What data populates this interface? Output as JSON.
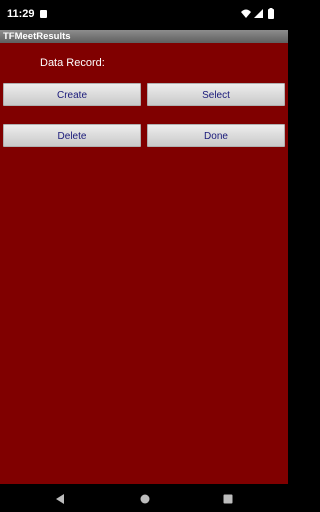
{
  "status_bar": {
    "time": "11:29",
    "icons": [
      "sim-icon",
      "wifi-icon",
      "signal-icon",
      "battery-icon"
    ]
  },
  "app": {
    "title": "TFMeetResults"
  },
  "main": {
    "data_record_label": "Data Record:",
    "buttons": {
      "create": "Create",
      "select": "Select",
      "delete": "Delete",
      "done": "Done"
    }
  },
  "nav_bar": {
    "icons": [
      "back-icon",
      "home-icon",
      "recents-icon"
    ]
  },
  "colors": {
    "background": "#800000",
    "button_text": "#1a1a7a",
    "title_bar": "#707070"
  }
}
